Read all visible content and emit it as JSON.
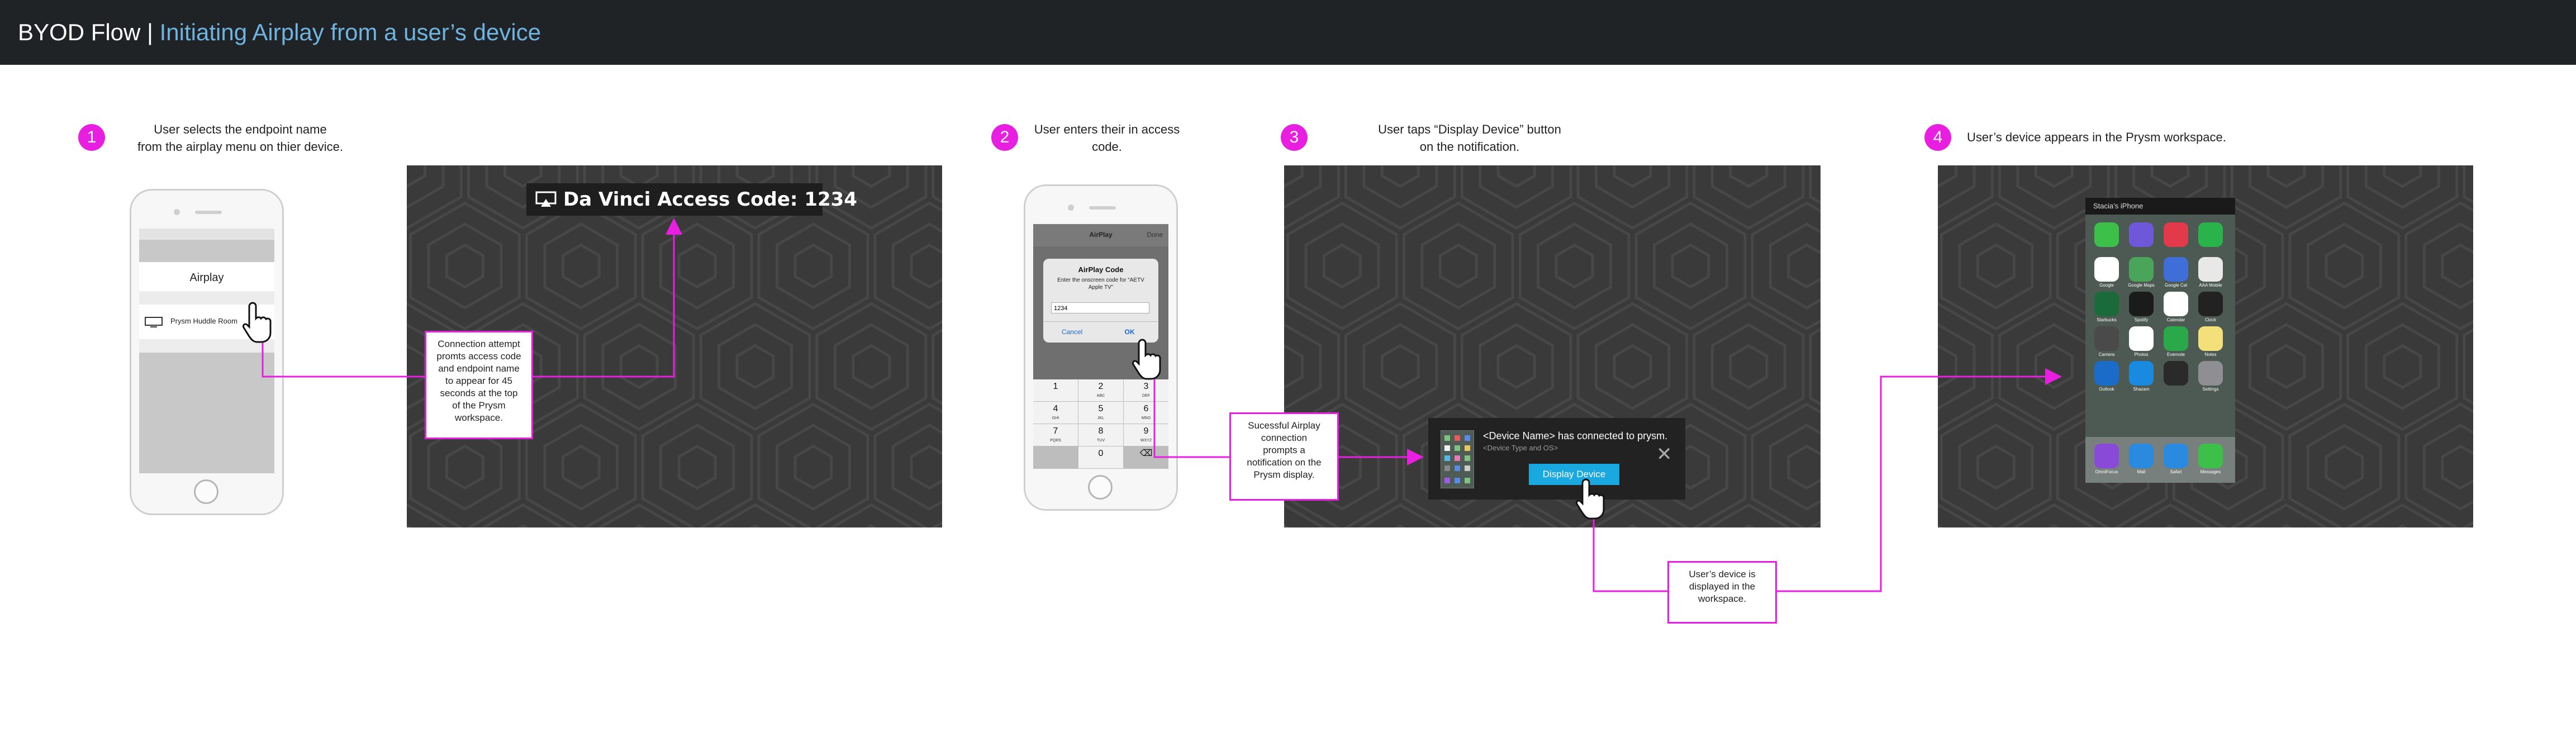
{
  "header": {
    "title_main": "BYOD Flow | ",
    "title_sub": "Initiating Airplay from a user’s device"
  },
  "steps": [
    {
      "number": "1",
      "caption_l1": "User selects the endpoint name",
      "caption_l2": "from the airplay menu on thier device."
    },
    {
      "number": "2",
      "caption_l1": "User enters their in access",
      "caption_l2": "code."
    },
    {
      "number": "3",
      "caption_l1": "User taps “Display Device” button",
      "caption_l2": "on the notification."
    },
    {
      "number": "4",
      "caption_l1": "User’s device appears in the Prysm workspace.",
      "caption_l2": ""
    }
  ],
  "phone1": {
    "menu_title": "Airplay",
    "device_name": "Prysm Huddle Room"
  },
  "display1": {
    "access_code": "Da Vinci Access Code: 1234"
  },
  "callouts": {
    "c1": [
      "Connection attempt",
      "promts access code",
      "and endpoint name",
      "to appear for 45",
      "seconds at the top",
      "of the Prysm",
      "workspace."
    ],
    "c2": [
      "Sucessful Airplay",
      "connection",
      "prompts a",
      "notification on the",
      "Prysm display."
    ],
    "c3": [
      "User’s device is",
      "displayed in the",
      "workspace."
    ]
  },
  "phone2": {
    "nav_title": "AirPlay",
    "nav_done": "Done",
    "dialog_title": "AirPlay Code",
    "dialog_msg_l1": "Enter the onscreen code for “AETV",
    "dialog_msg_l2": "Apple TV”",
    "input_value": "1234",
    "cancel": "Cancel",
    "ok": "OK",
    "keys": [
      {
        "d": "1",
        "s": ""
      },
      {
        "d": "2",
        "s": "ABC"
      },
      {
        "d": "3",
        "s": "DEF"
      },
      {
        "d": "4",
        "s": "GHI"
      },
      {
        "d": "5",
        "s": "JKL"
      },
      {
        "d": "6",
        "s": "MNO"
      },
      {
        "d": "7",
        "s": "PQRS"
      },
      {
        "d": "8",
        "s": "TUV"
      },
      {
        "d": "9",
        "s": "WXYZ"
      },
      {
        "d": "",
        "s": ""
      },
      {
        "d": "0",
        "s": ""
      },
      {
        "d": "⌫",
        "s": ""
      }
    ]
  },
  "notification": {
    "line1": "<Device Name> has connected to prysm.",
    "line2": "<Device Type and OS>",
    "button": "Display Device",
    "close": "✕"
  },
  "iphone": {
    "owner": "Stacia’s iPhone",
    "apps": [
      {
        "label": "",
        "color": "#3cc04a"
      },
      {
        "label": "",
        "color": "#6e57d8"
      },
      {
        "label": "",
        "color": "#e23a4a"
      },
      {
        "label": "",
        "color": "#2ab34a"
      },
      {
        "label": "Google",
        "color": "#ffffff"
      },
      {
        "label": "Google Maps",
        "color": "#4aa45a"
      },
      {
        "label": "Google Cal",
        "color": "#3f6ed8"
      },
      {
        "label": "AAA Mobile",
        "color": "#e8e8e8"
      },
      {
        "label": "Starbucks",
        "color": "#1b6a3a"
      },
      {
        "label": "Spotify",
        "color": "#1b1b1b"
      },
      {
        "label": "Calendar",
        "color": "#ffffff"
      },
      {
        "label": "Clock",
        "color": "#222222"
      },
      {
        "label": "Camera",
        "color": "#4a4a4a"
      },
      {
        "label": "Photos",
        "color": "#ffffff"
      },
      {
        "label": "Evernote",
        "color": "#2aa84a"
      },
      {
        "label": "Notes",
        "color": "#f4e07a"
      },
      {
        "label": "Outlook",
        "color": "#1a6cc8"
      },
      {
        "label": "Shazam",
        "color": "#1a8ae0"
      },
      {
        "label": "",
        "color": "#2a2a2a"
      },
      {
        "label": "Settings",
        "color": "#8e8e93"
      }
    ],
    "dock": [
      {
        "label": "OmniFocus",
        "color": "#8a4ad8"
      },
      {
        "label": "Mail",
        "color": "#2a8ae0"
      },
      {
        "label": "Safari",
        "color": "#2a8ae0"
      },
      {
        "label": "Messages",
        "color": "#3cc04a"
      }
    ]
  },
  "colors": {
    "accent": "#e81ee0",
    "header_bg": "#1f2326",
    "header_sub": "#6fb4e0",
    "panel_bg": "#3a3a3a",
    "button_blue": "#19a8e0"
  }
}
